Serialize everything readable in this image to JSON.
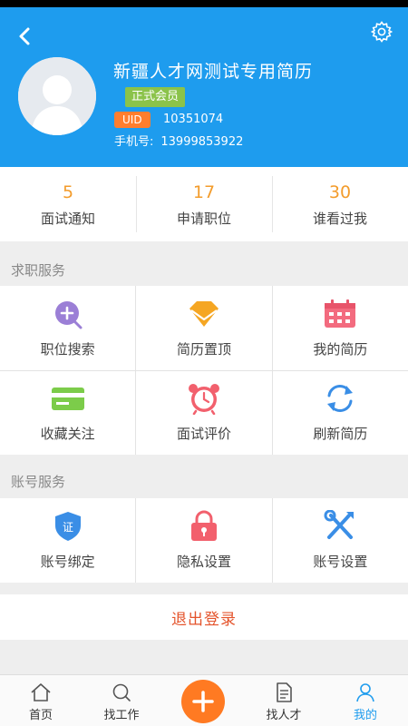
{
  "header": {
    "resume_title": "新疆人才网测试专用简历",
    "member_badge": "正式会员",
    "uid_label": "UID",
    "uid_value": "10351074",
    "phone_label": "手机号:",
    "phone_value": "13999853922"
  },
  "stats": [
    {
      "count": "5",
      "label": "面试通知"
    },
    {
      "count": "17",
      "label": "申请职位"
    },
    {
      "count": "30",
      "label": "谁看过我"
    }
  ],
  "job_services": {
    "title": "求职服务",
    "items": [
      {
        "label": "职位搜索",
        "icon": "search-plus-icon"
      },
      {
        "label": "简历置顶",
        "icon": "diamond-icon"
      },
      {
        "label": "我的简历",
        "icon": "calendar-icon"
      },
      {
        "label": "收藏关注",
        "icon": "card-icon"
      },
      {
        "label": "面试评价",
        "icon": "alarm-clock-icon"
      },
      {
        "label": "刷新简历",
        "icon": "refresh-icon"
      }
    ]
  },
  "account_services": {
    "title": "账号服务",
    "items": [
      {
        "label": "账号绑定",
        "icon": "certificate-shield-icon",
        "icon_text": "证"
      },
      {
        "label": "隐私设置",
        "icon": "lock-icon"
      },
      {
        "label": "账号设置",
        "icon": "tools-icon"
      }
    ]
  },
  "logout_label": "退出登录",
  "tabbar": {
    "tabs": [
      {
        "label": "首页",
        "icon": "home-icon"
      },
      {
        "label": "找工作",
        "icon": "search-icon"
      },
      {
        "label": "找人才",
        "icon": "document-icon"
      },
      {
        "label": "我的",
        "icon": "user-icon",
        "active": true
      }
    ],
    "center_button_icon": "plus-icon"
  },
  "colors": {
    "header_bg": "#1e9cee",
    "stat_number": "#f39c2c",
    "logout_text": "#e4542c",
    "plus_button": "#ff7a22",
    "member_badge": "#8bc34a",
    "uid_badge": "#ff7e2e"
  }
}
